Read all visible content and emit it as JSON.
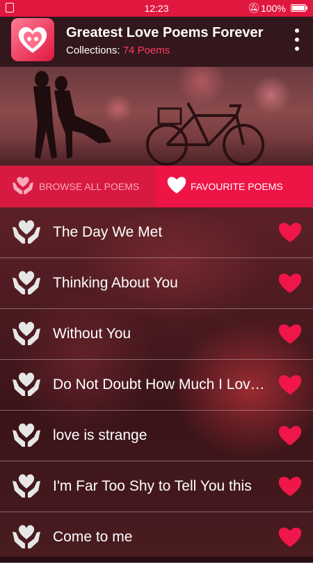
{
  "statusbar": {
    "time": "12:23",
    "battery": "100%"
  },
  "header": {
    "title": "Greatest Love Poems Forever",
    "collections_label": "Collections:",
    "collections_count": "74 Poems"
  },
  "tabs": [
    {
      "label": "BROWSE ALL POEMS",
      "active": false
    },
    {
      "label": "FAVOURITE POEMS",
      "active": true
    }
  ],
  "poems": [
    {
      "title": "The Day We Met"
    },
    {
      "title": "Thinking About You"
    },
    {
      "title": "Without You"
    },
    {
      "title": "Do Not Doubt How Much I Love You"
    },
    {
      "title": "love is strange"
    },
    {
      "title": "I'm Far Too Shy to Tell You this"
    },
    {
      "title": "Come to me"
    }
  ],
  "colors": {
    "accent": "#e0173f",
    "heart": "#f0164a",
    "count": "#ff3d63"
  },
  "icons": {
    "row_left": "heart-in-hands-icon",
    "row_right": "heart-icon",
    "menu": "more-vertical-icon"
  }
}
